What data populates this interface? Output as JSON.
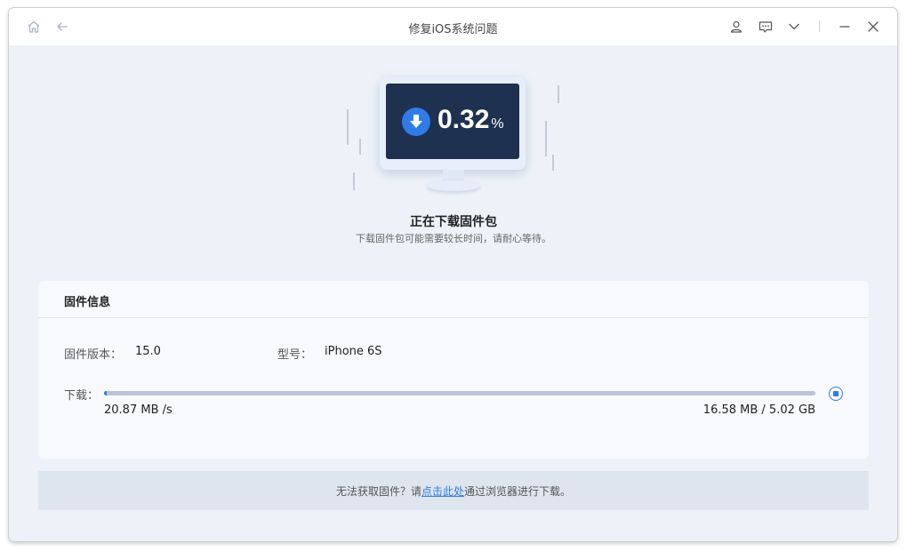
{
  "window": {
    "title": "修复iOS系统问题"
  },
  "download": {
    "percent_value": "0.32",
    "percent_sign": "%",
    "progress": 0.0032
  },
  "status": {
    "heading": "正在下载固件包",
    "subheading": "下载固件包可能需要较长时间，请耐心等待。"
  },
  "firmware": {
    "section_title": "固件信息",
    "version_label": "固件版本：",
    "version_value": "15.0",
    "model_label": "型号：",
    "model_value": "iPhone 6S",
    "download_label": "下载：",
    "speed": "20.87 MB /s",
    "size": "16.58 MB / 5.02 GB"
  },
  "footer": {
    "prefix": "无法获取固件？请",
    "link": "点击此处",
    "suffix": "通过浏览器进行下载。"
  },
  "icons": [
    "home-icon",
    "back-arrow-icon",
    "user-icon",
    "feedback-icon",
    "chevron-down-icon",
    "minimize-icon",
    "close-icon",
    "download-arrow-icon",
    "stop-icon"
  ],
  "colors": {
    "accent": "#2f7ce8",
    "screen": "#1f3150",
    "background": "#eef2f8"
  }
}
